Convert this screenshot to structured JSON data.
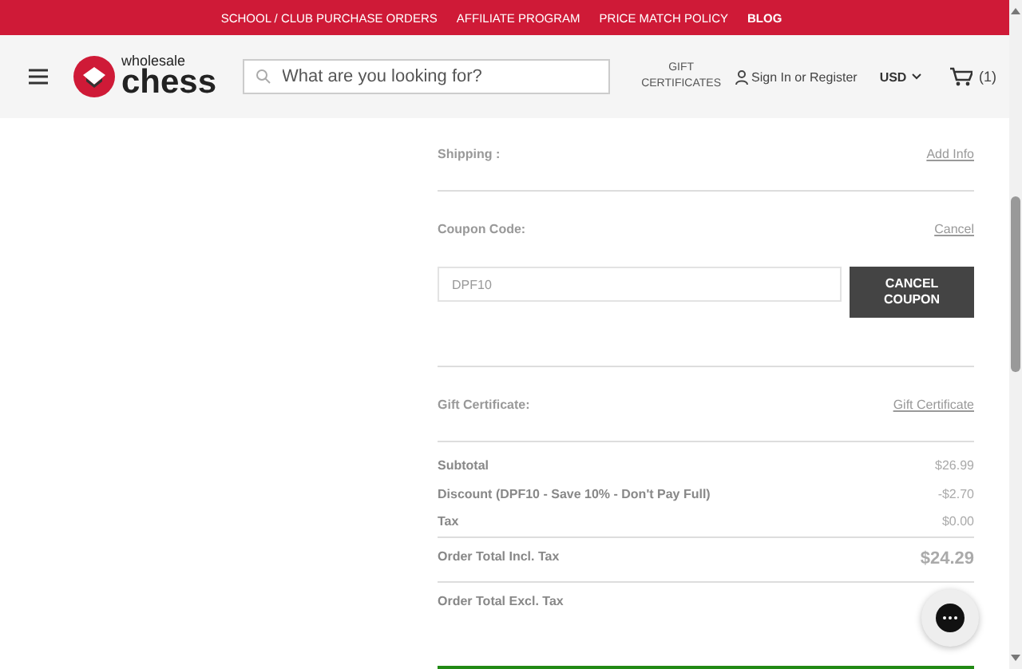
{
  "top_links": [
    {
      "label": "SCHOOL / CLUB PURCHASE ORDERS",
      "bold": false
    },
    {
      "label": "AFFILIATE PROGRAM",
      "bold": false
    },
    {
      "label": "PRICE MATCH POLICY",
      "bold": false
    },
    {
      "label": "BLOG",
      "bold": true
    }
  ],
  "header": {
    "logo_small": "wholesale",
    "logo_big": "chess",
    "search": {
      "placeholder": "What are you looking for?"
    },
    "gift": "GIFT CERTIFICATES",
    "account": "Sign In or Register",
    "currency": "USD",
    "cart_count": "(1)"
  },
  "shipping": {
    "label": "Shipping :",
    "link": "Add Info"
  },
  "coupon": {
    "label": "Coupon Code:",
    "link": "Cancel",
    "value": "DPF10",
    "button": "CANCEL COUPON"
  },
  "gift_certificate": {
    "label": "Gift Certificate:",
    "link": "Gift Certificate"
  },
  "totals": [
    {
      "kind": "line",
      "label": "Subtotal",
      "value": "$26.99"
    },
    {
      "kind": "line",
      "label": "Discount (DPF10 - Save 10% - Don't Pay Full)",
      "value": "-$2.70"
    },
    {
      "kind": "line",
      "label": "Tax",
      "value": "$0.00"
    },
    {
      "kind": "grand",
      "label": "Order Total Incl. Tax",
      "value": "$24.29"
    },
    {
      "kind": "total",
      "label": "Order Total Excl. Tax"
    }
  ]
}
